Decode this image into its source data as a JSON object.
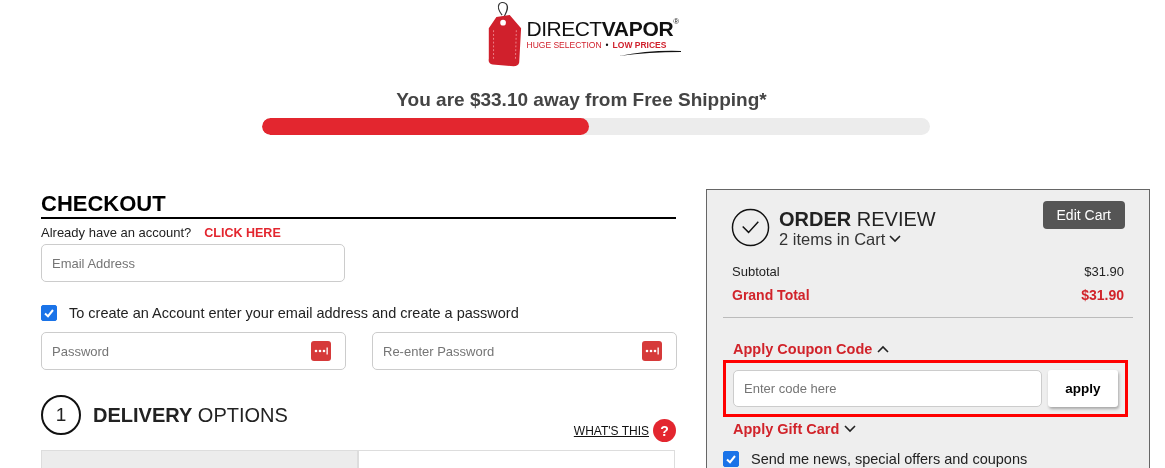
{
  "logo": {
    "brand_light": "DIRECT",
    "brand_bold": "VAPOR",
    "registered": "®",
    "tagline_left": "HUGE SELECTION",
    "separator": "•",
    "tagline_right": "LOW PRICES"
  },
  "shipping": {
    "message": "You are $33.10 away from Free Shipping*",
    "level": 0.49
  },
  "checkout": {
    "title": "CHECKOUT",
    "account_prompt": "Already have an account?",
    "login_link": "CLICK HERE",
    "email": {
      "placeholder": "Email Address"
    },
    "create_account": {
      "checked": true,
      "label": "To create an Account enter your email address and create a password"
    },
    "password": {
      "placeholder": "Password"
    },
    "confirm_password": {
      "placeholder": "Re-enter Password"
    },
    "step": {
      "number": "1",
      "title_bold": "DELIVERY",
      "title_light": "OPTIONS",
      "help_link": "WHAT'S THIS",
      "help_icon": "?"
    }
  },
  "order_review": {
    "title_bold": "ORDER",
    "title_light": "REVIEW",
    "items": "2 items in Cart",
    "items_expanded": false,
    "edit_button": "Edit Cart",
    "totals": [
      {
        "kind": "normal",
        "label": "Subtotal",
        "value": "$31.90"
      },
      {
        "kind": "grand",
        "label": "Grand Total",
        "value": "$31.90"
      }
    ],
    "coupon": {
      "label": "Apply Coupon Code",
      "expanded": true,
      "placeholder": "Enter code here",
      "button": "apply",
      "highlighted": true
    },
    "gift_card": {
      "label": "Apply Gift Card",
      "expanded": false
    },
    "newsletter": {
      "checked": true,
      "label": "Send me news, special offers and coupons"
    }
  }
}
